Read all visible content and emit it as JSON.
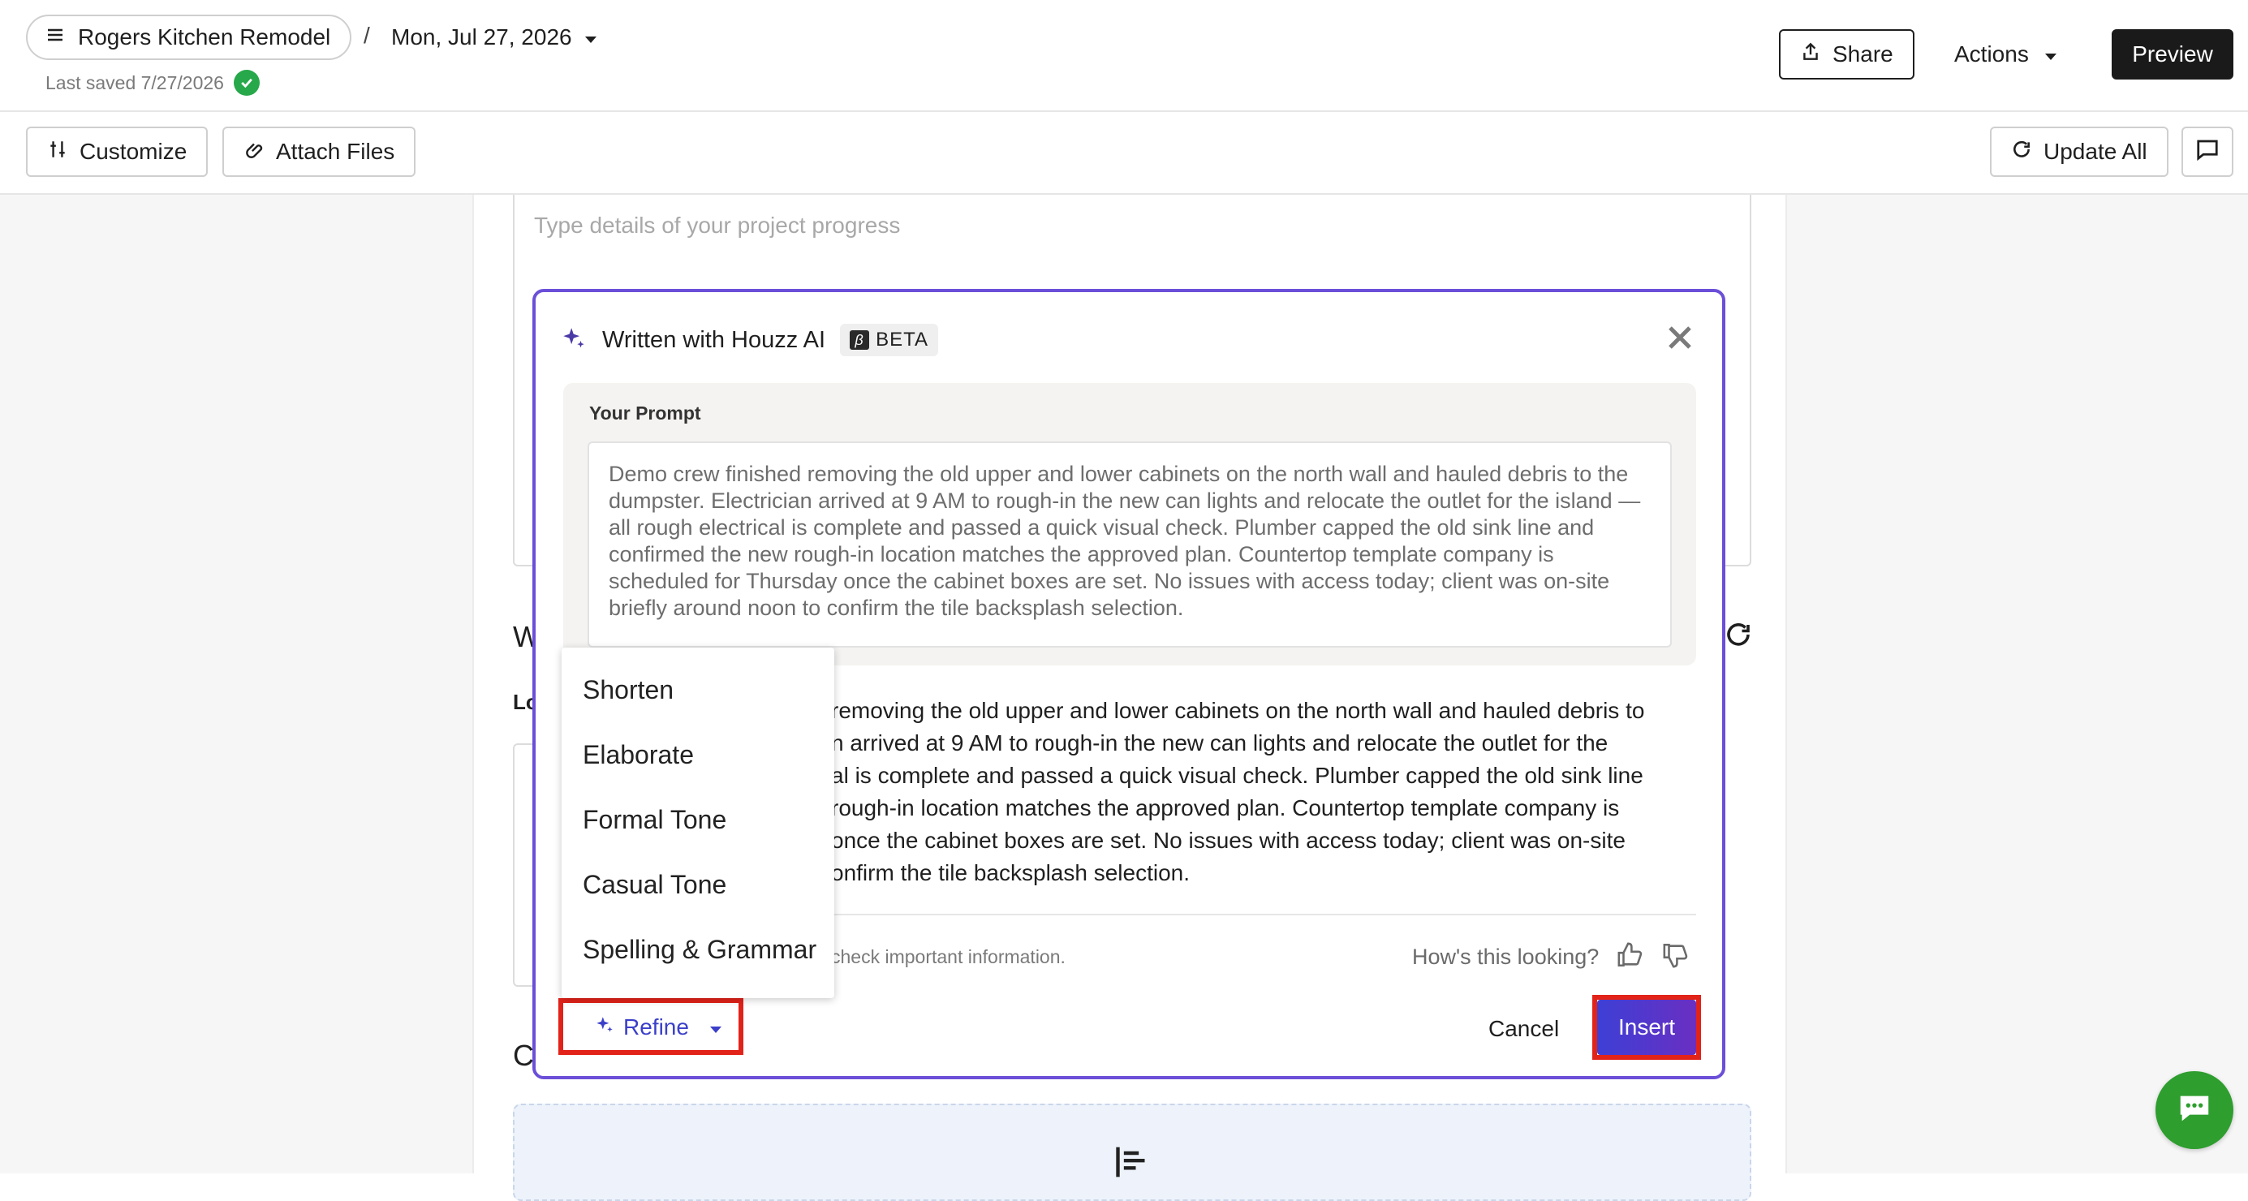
{
  "header": {
    "project_name": "Rogers Kitchen Remodel",
    "separator": "/",
    "date": "Mon, Jul 27, 2026",
    "last_saved": "Last saved 7/27/2026",
    "share_label": "Share",
    "actions_label": "Actions",
    "preview_label": "Preview"
  },
  "toolbar": {
    "customize_label": "Customize",
    "attach_label": "Attach Files",
    "update_all_label": "Update All"
  },
  "editor": {
    "placeholder": "Type details of your project progress",
    "peek_heading_w": "W",
    "peek_label_lo": "Lo",
    "peek_heading_c": "C"
  },
  "ai_panel": {
    "title": "Written with Houzz AI",
    "beta_label": "BETA",
    "prompt_label": "Your Prompt",
    "prompt_text": "Demo crew finished removing the old upper and lower cabinets on the north wall and hauled debris to the dumpster. Electrician arrived at 9 AM to rough-in the new can lights and relocate the outlet for the island — all rough electrical is complete and passed a quick visual check. Plumber capped the old sink line and confirmed the new rough-in location matches the approved plan. Countertop template company is scheduled for Thursday once the cabinet boxes are set. No issues with access today; client was on-site briefly around noon to confirm the tile backsplash selection.",
    "result_lines": [
      "removing the old upper and lower cabinets on the north wall and hauled debris to",
      "n arrived at 9 AM to rough-in the new can lights and relocate the outlet for the",
      "al is complete and passed a quick visual check. Plumber capped the old sink line",
      "rough-in location matches the approved plan. Countertop template company is",
      "once the cabinet boxes are set. No issues with access today; client was on-site",
      "onfirm the tile backsplash selection."
    ],
    "disclaimer": "check important information.",
    "feedback_question": "How's this looking?",
    "refine_label": "Refine",
    "cancel_label": "Cancel",
    "insert_label": "Insert"
  },
  "refine_menu": {
    "items": [
      "Shorten",
      "Elaborate",
      "Formal Tone",
      "Casual Tone",
      "Spelling & Grammar"
    ]
  },
  "colors": {
    "accent_purple": "#6b4fd8",
    "insert_gradient_start": "#3d3fd6",
    "insert_gradient_end": "#6a2fc2",
    "highlight_red": "#e2231a",
    "saved_green": "#27a84a",
    "chat_green": "#2e9e2e"
  },
  "icons": {
    "menu": "hamburger-icon",
    "share": "share-icon",
    "customize": "sliders-icon",
    "attach": "paperclip-icon",
    "update": "refresh-icon",
    "comment": "comment-icon",
    "sparkle": "sparkle-icon",
    "close": "close-icon",
    "thumbs_up": "thumbs-up-icon",
    "thumbs_down": "thumbs-down-icon",
    "chat": "chat-bubble-icon"
  }
}
